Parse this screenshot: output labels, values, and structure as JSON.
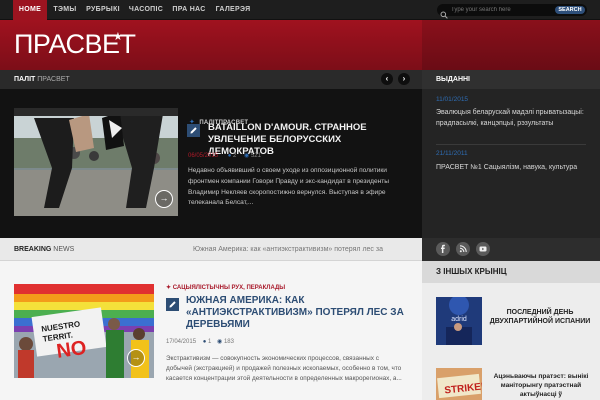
{
  "nav": {
    "items": [
      {
        "label": "HOME",
        "active": true
      },
      {
        "label": "ТЭМЫ"
      },
      {
        "label": "РУБРЫКІ"
      },
      {
        "label": "ЧАСОПІС"
      },
      {
        "label": "ПРА НАС"
      },
      {
        "label": "ГАЛЕРЭЯ"
      }
    ],
    "search_placeholder": "Type your search here",
    "search_button": "SEARCH"
  },
  "header": {
    "logo": "ПРАСВЕТ",
    "logo_star": "★"
  },
  "featured_section": {
    "title_bold": "ПАЛІТ",
    "title_rest": "ПРАСВЕТ",
    "prev_arrow": "‹",
    "next_arrow": "›"
  },
  "featured": {
    "category": "ПАЛІТПРАСВЕТ",
    "title": "BATAILLON D'AMOUR. СТРАННОЕ УВЛЕЧЕНИЕ БЕЛОРУССКИХ ДЕМОКРАТОВ",
    "date": "06/05/2015",
    "comments": "2",
    "views": "521",
    "excerpt": "Недавно объявивший о своем уходе из оппозиционной политики фронтмен компании Говори Правду и экс-кандидат в президенты Владимир Некляев скоропостижно вернулся. Выступая в эфире телеканала Белсат,...",
    "more_arrow": "→"
  },
  "issues": {
    "title": "ВЫДАННІ",
    "items": [
      {
        "date": "11/01/2015",
        "title": "Эвалюцыя беларускай мадэлі прыватызацыі: прадпасылкі, канцэпцыі, рэзультаты"
      },
      {
        "date": "21/11/2011",
        "title": "ПРАСВЕТ №1 Сацыялізм, навука, культура"
      }
    ]
  },
  "breaking": {
    "label_bold": "BREAKING",
    "label_rest": "NEWS",
    "text": "Южная Америка: как «антиэкстрактивизм» потерял лес за"
  },
  "social": {
    "icons": [
      "f",
      "rss",
      "yt"
    ]
  },
  "article": {
    "category": "САЦЫЯЛІСТЫЧНЫ РУХ, ПЕРАКЛАДЫ",
    "title": "ЮЖНАЯ АМЕРИКА: КАК «АНТИЭКСТРАКТИВИЗМ» ПОТЕРЯЛ ЛЕС ЗА ДЕРЕВЬЯМИ",
    "date": "17/04/2015",
    "comments": "1",
    "views": "183",
    "excerpt": "Экстрактивизм — совокупность экономических процессов, связанных с добычей (экстракцией) и продажей полезных ископаемых, особенно в том, что касается концентрации этой деятельности в определенных макрорегионах, а...",
    "more_arrow": "→"
  },
  "other_sources": {
    "title": "З ІНШЫХ КРЫНІЦ",
    "items": [
      {
        "title": "ПОСЛЕДНИЙ ДЕНЬ ДВУХПАРТИЙНОЙ ИСПАНИИ"
      },
      {
        "title": "Ацэньваючы пратэст: вынікі маніторынгу пратэстнай актыўнасці ў"
      }
    ]
  },
  "colors": {
    "brand_red": "#9c1420",
    "accent_blue": "#2d4d74",
    "date_blue": "#2e6cb3"
  }
}
